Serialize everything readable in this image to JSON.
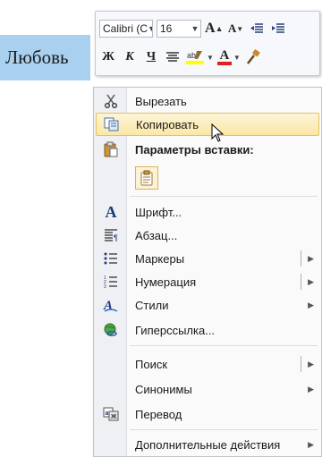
{
  "document": {
    "selected_word": "Любовь"
  },
  "mini_toolbar": {
    "font_name": "Calibri (С",
    "font_size": "16",
    "grow_font": "A",
    "shrink_font": "A",
    "bold": "Ж",
    "italic": "К",
    "underline": "Ч",
    "font_color_letter": "A",
    "highlight_label": "ab"
  },
  "context_menu": {
    "items": [
      {
        "label": "Вырезать",
        "icon": "scissors-icon"
      },
      {
        "label": "Копировать",
        "icon": "copy-icon",
        "state": "hover"
      },
      {
        "label": "Параметры вставки:",
        "type": "header",
        "icon": "paste-icon"
      },
      {
        "label": "Шрифт...",
        "icon": "font-icon"
      },
      {
        "label": "Абзац...",
        "icon": "paragraph-icon"
      },
      {
        "label": "Маркеры",
        "icon": "bullets-icon",
        "submenu": true
      },
      {
        "label": "Нумерация",
        "icon": "numbering-icon",
        "submenu": true
      },
      {
        "label": "Стили",
        "icon": "styles-icon",
        "submenu": true
      },
      {
        "label": "Гиперссылка...",
        "icon": "hyperlink-icon"
      },
      {
        "label": "Поиск",
        "icon": "",
        "submenu": true
      },
      {
        "label": "Синонимы",
        "icon": "",
        "submenu": true
      },
      {
        "label": "Перевод",
        "icon": "translate-icon"
      },
      {
        "label": "Дополнительные действия",
        "icon": "",
        "submenu": true
      }
    ]
  },
  "colors": {
    "selection": "#a9d1ef",
    "hover_top": "#fdf5d8",
    "hover_bottom": "#fbe7a5",
    "font_color_red": "#e02020",
    "highlight_yellow": "#ffff00"
  }
}
